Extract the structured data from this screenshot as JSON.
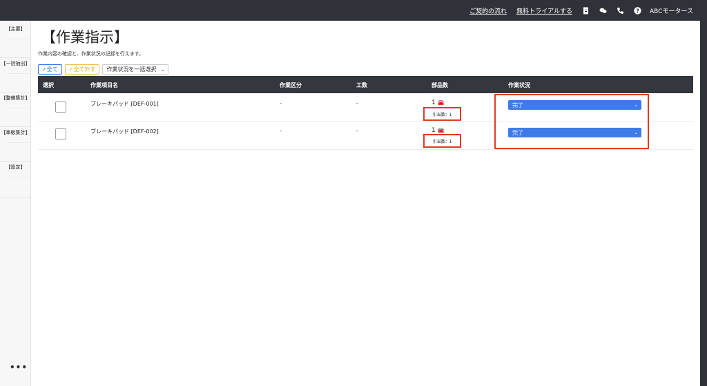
{
  "topbar": {
    "link_contract": "ご契約の流れ",
    "link_trial": "無料トライアルする",
    "icons": [
      "document-icon",
      "chat-icon",
      "phone-icon",
      "help-icon"
    ],
    "company": "ABCモータース"
  },
  "sidebar": {
    "items": [
      {
        "label": "【主要】",
        "icon": "home-icon"
      },
      {
        "label": "【一括抽出】",
        "icon": "export-icon"
      },
      {
        "label": "【整備集計】",
        "icon": "wrench-icon"
      },
      {
        "label": "【車販集計】",
        "icon": "car-icon"
      },
      {
        "label": "【設定】",
        "icon": "gear-icon"
      }
    ],
    "more": "•••"
  },
  "page": {
    "title": "【作業指示】",
    "subtitle": "作業内容の確認と、作業状況の記録を行えます。"
  },
  "toolbar": {
    "select_all": "✓全て",
    "deselect_all": "✓全て外す",
    "bulk_status": "作業状況を一括選択"
  },
  "table": {
    "headers": {
      "select": "選択",
      "item": "作業項目名",
      "category": "作業区分",
      "hours": "工数",
      "parts": "部品数",
      "status": "作業状況"
    },
    "rows": [
      {
        "item": "ブレーキパッド [DEF-001]",
        "category": "-",
        "hours": "-",
        "parts": "1",
        "allocated": "引当数：1",
        "status": "完了"
      },
      {
        "item": "ブレーキパッド [DEF-002]",
        "category": "-",
        "hours": "-",
        "parts": "1",
        "allocated": "引当数：1",
        "status": "完了"
      }
    ]
  },
  "colors": {
    "topbar": "#2f3238",
    "accent_blue": "#3f7be6",
    "highlight_red": "#e03a22",
    "table_header": "#34373d"
  }
}
